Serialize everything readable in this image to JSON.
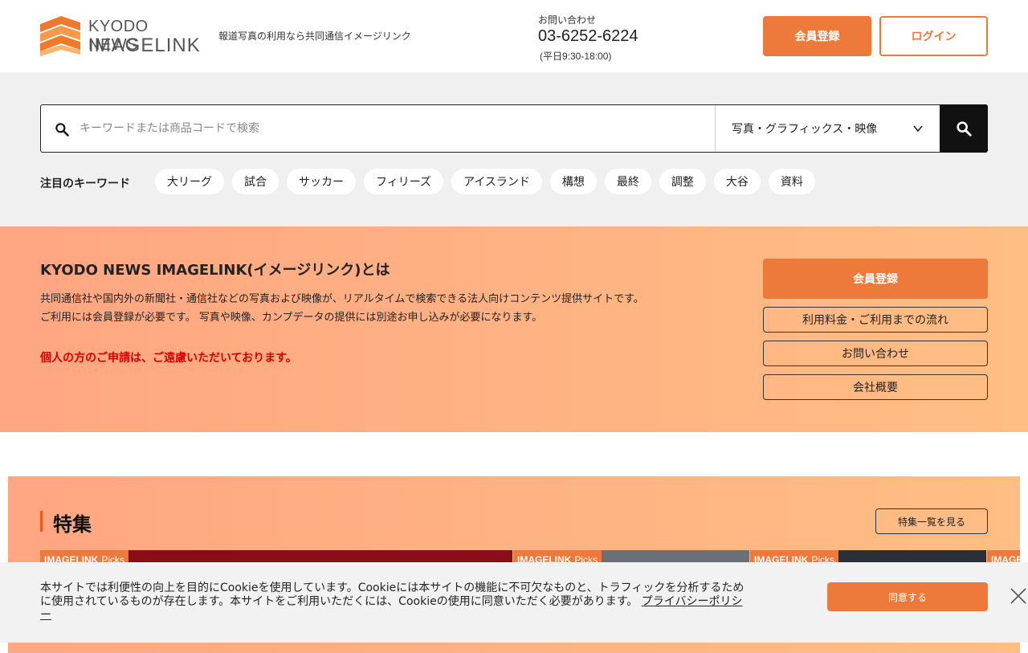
{
  "header": {
    "logo_line1": "KYODO NEWS",
    "logo_line2": "IMAGELINK",
    "tagline": "報道写真の利用なら共同通信イメージリンク",
    "contact_label": "お問い合わせ",
    "contact_phone": "03-6252-6224",
    "contact_hours": "(平日9:30-18:00)",
    "register_label": "会員登録",
    "login_label": "ログイン"
  },
  "search": {
    "placeholder": "キーワードまたは商品コードで検索",
    "category": "写真・グラフィックス・映像",
    "keywords_label": "注目のキーワード",
    "keywords": [
      "大リーグ",
      "試合",
      "サッカー",
      "フィリーズ",
      "アイスランド",
      "構想",
      "最終",
      "調整",
      "大谷",
      "資料"
    ]
  },
  "about": {
    "title": "KYODO NEWS IMAGELINK(イメージリンク)とは",
    "desc1": "共同通信社や国内外の新聞社・通信社などの写真および映像が、リアルタイムで検索できる法人向けコンテンツ提供サイトです。",
    "desc2": "ご利用には会員登録が必要です。 写真や映像、カンプデータの提供には別途お申し込みが必要になります。",
    "notice": "個人の方のご申請は、ご遠慮いただいております。",
    "register_label": "会員登録",
    "pricing_label": "利用料金・ご利用までの流れ",
    "contact_label": "お問い合わせ",
    "company_label": "会社概要"
  },
  "feature": {
    "title": "特集",
    "more_label": "特集一覧を見る",
    "card_tag_brand": "IMAGELINK",
    "card_tag_picks": "Picks"
  },
  "cookie": {
    "text": "本サイトでは利便性の向上を目的にCookieを使用しています。Cookieには本サイトの機能に不可欠なものと、トラフィックを分析するために使用されているものが存在します。本サイトをご利用いただくには、Cookieの使用に同意いただく必要があります。 ",
    "link_label": "プライバシーポリシー",
    "accept_label": "同意する"
  },
  "colors": {
    "accent": "#ed7a3a",
    "notice_red": "#d60000",
    "gradient_start": "#ffa682",
    "gradient_end": "#ffbe84"
  }
}
